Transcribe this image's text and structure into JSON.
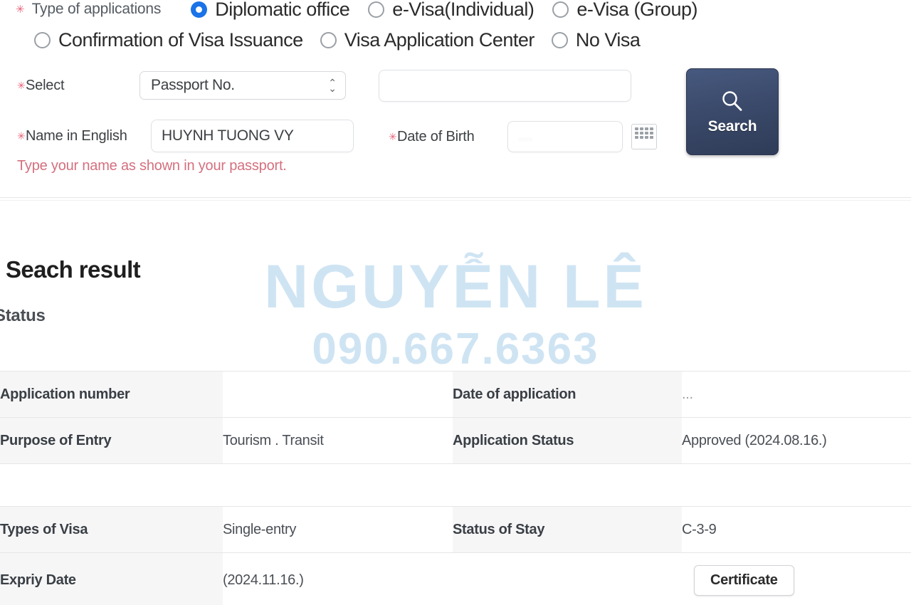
{
  "application_type": {
    "label": "Type of applications",
    "options": [
      {
        "label": "Diplomatic office",
        "selected": true
      },
      {
        "label": "e-Visa(Individual)",
        "selected": false
      },
      {
        "label": "e-Visa (Group)",
        "selected": false
      },
      {
        "label": "Confirmation of Visa Issuance",
        "selected": false
      },
      {
        "label": "Visa Application Center",
        "selected": false
      },
      {
        "label": "No Visa",
        "selected": false
      }
    ]
  },
  "form": {
    "select_label": "Select",
    "select_value": "Passport No.",
    "passport_value": "",
    "passport_placeholder": "",
    "name_label": "Name in English",
    "name_value": "HUYNH TUONG VY",
    "dob_label": "Date of Birth",
    "dob_value": "....",
    "calendar_icon": "calendar-icon",
    "search_button": "Search",
    "search_icon": "search-icon",
    "hint": "Type your name as shown in your passport."
  },
  "results": {
    "title": "Seach result",
    "status_label": "Status",
    "rows": [
      {
        "left_label": "Application number",
        "left_value": "",
        "right_label": "Date of application",
        "right_value": "..."
      },
      {
        "left_label": "Purpose of Entry",
        "left_value": "Tourism . Transit",
        "right_label": "Application Status",
        "right_value": "Approved (2024.08.16.)"
      }
    ],
    "rows2": [
      {
        "left_label": "Types of Visa",
        "left_value": "Single-entry",
        "right_label": "Status of Stay",
        "right_value": "C-3-9"
      },
      {
        "left_label": "Expriy Date",
        "left_value": "(2024.11.16.)",
        "right_label": "",
        "right_value": ""
      }
    ],
    "certificate_button": "Certificate"
  },
  "watermark": {
    "name": "NGUYỄN LÊ",
    "phone": "090.667.6363",
    "color": "#cfe4f3"
  },
  "colors": {
    "accent_blue": "#1a73e8",
    "required_star": "#e8637a",
    "hint_text": "#d4707f",
    "search_button": "#3b4a6b",
    "label_cell_bg": "#f6f6f7"
  }
}
